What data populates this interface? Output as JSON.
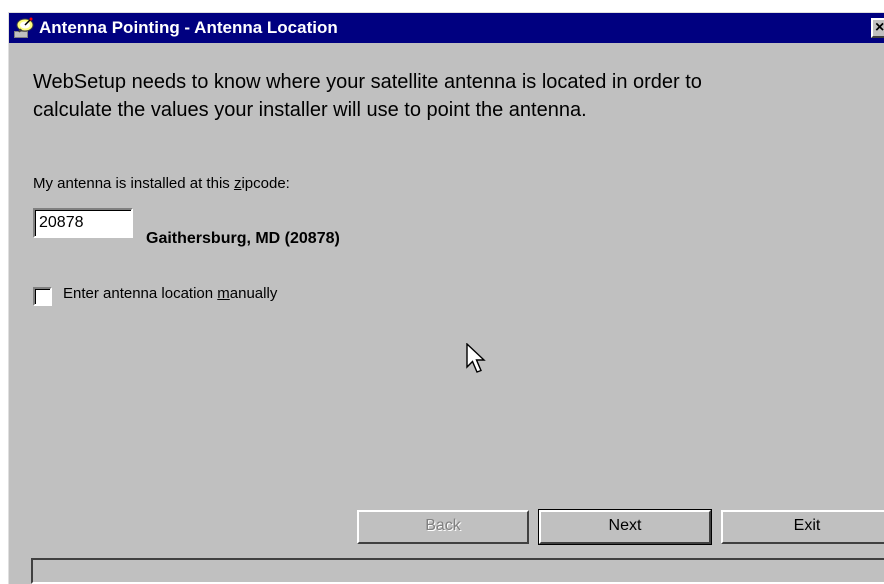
{
  "window": {
    "title": "Antenna Pointing - Antenna Location",
    "close_glyph": "×",
    "icon": "satellite-dish-icon"
  },
  "intro": {
    "line1": "WebSetup needs to know where your satellite antenna is located in order to",
    "line2": "calculate the values your installer will use to point the antenna."
  },
  "zipcode": {
    "label_prefix": "My antenna is installed at this ",
    "label_accel": "z",
    "label_suffix": "ipcode:",
    "value": "20878",
    "resolved_location": "Gaithersburg, MD (20878)"
  },
  "manual_location": {
    "label_prefix": "Enter antenna location ",
    "label_accel": "m",
    "label_suffix": "anually",
    "checked": false
  },
  "buttons": {
    "back": "Back",
    "next": "Next",
    "exit": "Exit"
  },
  "status": {
    "text": ""
  },
  "colors": {
    "titlebar": "#000080",
    "face": "#c0c0c0",
    "disabled_text": "#808080"
  }
}
